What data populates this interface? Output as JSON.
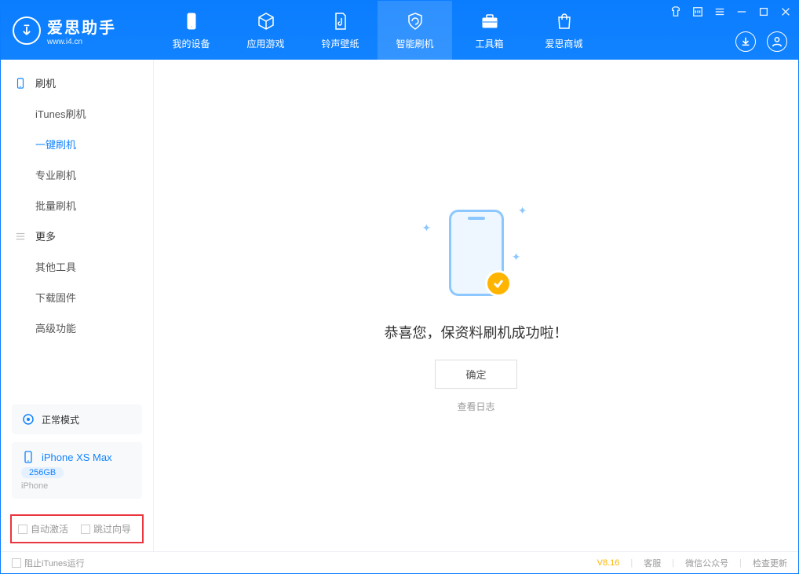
{
  "header": {
    "logo_title": "爱思助手",
    "logo_sub": "www.i4.cn",
    "nav": [
      {
        "label": "我的设备"
      },
      {
        "label": "应用游戏"
      },
      {
        "label": "铃声壁纸"
      },
      {
        "label": "智能刷机"
      },
      {
        "label": "工具箱"
      },
      {
        "label": "爱思商城"
      }
    ]
  },
  "sidebar": {
    "group1_title": "刷机",
    "group1_items": [
      "iTunes刷机",
      "一键刷机",
      "专业刷机",
      "批量刷机"
    ],
    "group2_title": "更多",
    "group2_items": [
      "其他工具",
      "下载固件",
      "高级功能"
    ],
    "mode_label": "正常模式",
    "device_name": "iPhone XS Max",
    "device_capacity": "256GB",
    "device_type": "iPhone",
    "check_auto": "自动激活",
    "check_skip": "跳过向导"
  },
  "main": {
    "success": "恭喜您，保资料刷机成功啦！",
    "ok": "确定",
    "view_log": "查看日志"
  },
  "footer": {
    "block_itunes": "阻止iTunes运行",
    "version": "V8.16",
    "support": "客服",
    "wechat": "微信公众号",
    "update": "检查更新"
  }
}
